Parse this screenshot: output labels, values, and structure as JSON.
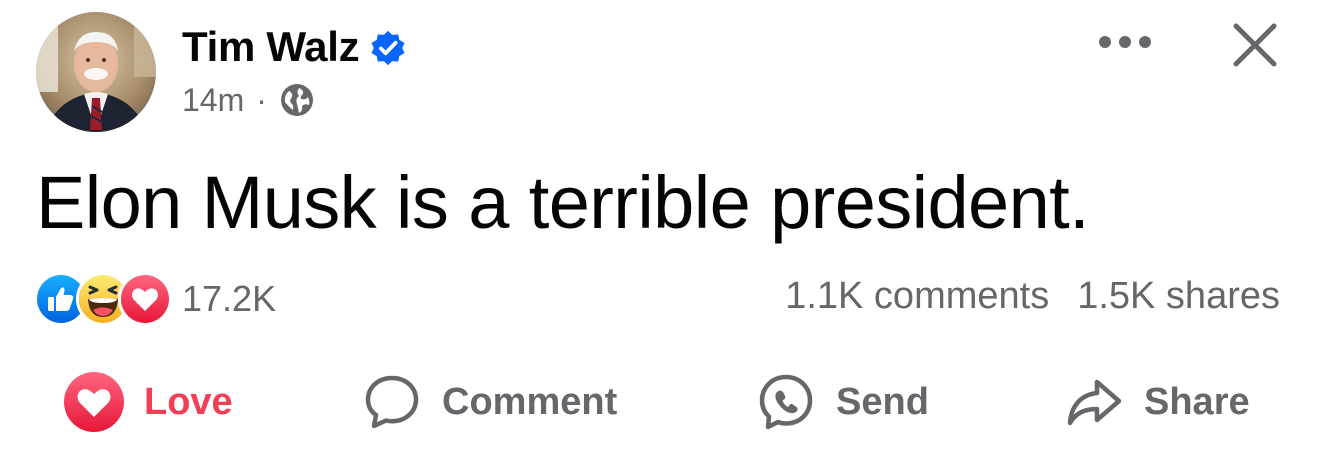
{
  "post": {
    "author": {
      "name": "Tim Walz",
      "verified": true,
      "avatar": "avatar-photo"
    },
    "meta": {
      "time": "14m",
      "separator": "·",
      "audience_icon": "globe-icon"
    },
    "header_actions": {
      "more_icon": "more-horizontal-icon",
      "close_icon": "close-icon"
    },
    "text": "Elon Musk is a terrible president.",
    "reactions": {
      "icons": [
        "like-reaction-icon",
        "haha-reaction-icon",
        "love-reaction-icon"
      ],
      "count": "17.2K"
    },
    "stats": {
      "comments": "1.1K comments",
      "shares": "1.5K shares"
    },
    "actions": [
      {
        "label": "Love",
        "icon": "love-reaction-icon",
        "active": true
      },
      {
        "label": "Comment",
        "icon": "comment-bubble-icon",
        "active": false
      },
      {
        "label": "Send",
        "icon": "messenger-icon",
        "active": false
      },
      {
        "label": "Share",
        "icon": "share-arrow-icon",
        "active": false
      }
    ],
    "colors": {
      "verified_blue": "#0866ff",
      "love_red": "#f33e58",
      "secondary_text": "#65676b",
      "primary_text": "#050505"
    }
  }
}
